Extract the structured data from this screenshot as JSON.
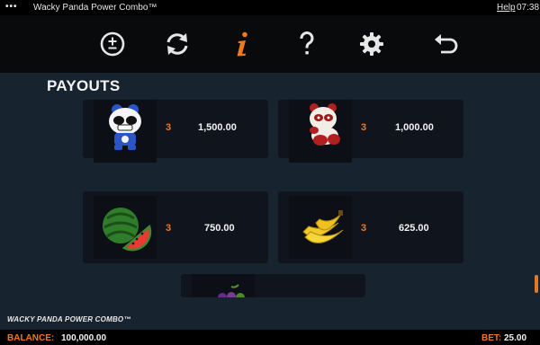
{
  "titlebar": {
    "dots": "•••",
    "title": "Wacky Panda Power Combo™",
    "help": "Help",
    "time": "07:38"
  },
  "navbar": {
    "icons": [
      "bet-settings-icon",
      "autoplay-icon",
      "info-icon",
      "help-icon",
      "settings-icon",
      "back-icon"
    ],
    "active": "info-icon",
    "accent_color": "#f07820"
  },
  "page_title": "PAYOUTS",
  "payouts": [
    {
      "symbol": "panda-blue-icon",
      "count": "3",
      "amount": "1,500.00"
    },
    {
      "symbol": "panda-red-icon",
      "count": "3",
      "amount": "1,000.00"
    },
    {
      "symbol": "watermelon-icon",
      "count": "3",
      "amount": "750.00"
    },
    {
      "symbol": "banana-icon",
      "count": "3",
      "amount": "625.00"
    }
  ],
  "partial_symbol": "grapes-icon",
  "logo": "WACKY PANDA POWER COMBO™",
  "bottombar": {
    "balance_label": "BALANCE:",
    "balance_value": "100,000.00",
    "bet_label": "BET:",
    "bet_value": "25.00"
  }
}
